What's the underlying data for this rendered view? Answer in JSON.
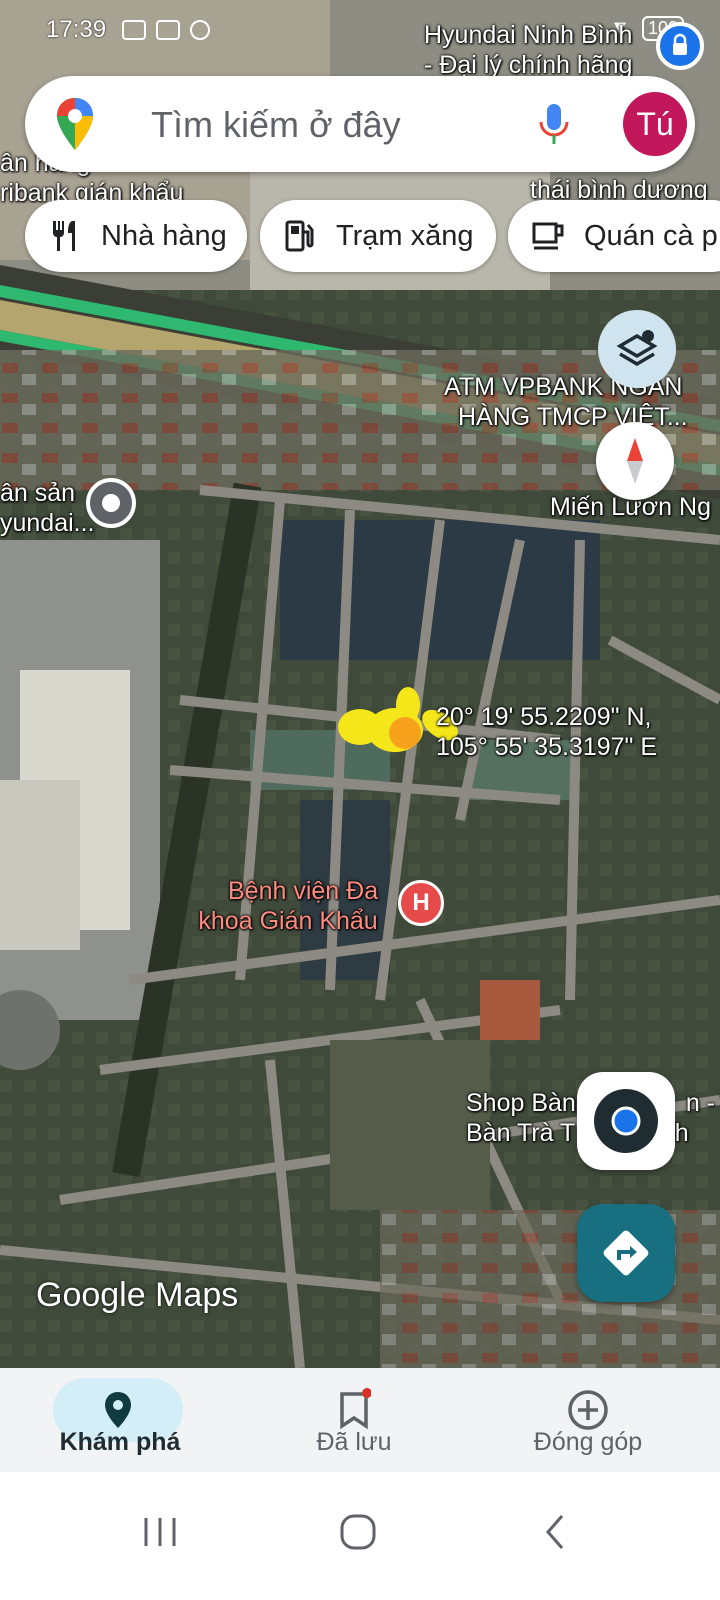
{
  "status_bar": {
    "time": "17:39",
    "battery": "100"
  },
  "search": {
    "placeholder": "Tìm kiếm ở đây",
    "avatar_initial": "Tú"
  },
  "chips": [
    {
      "label": "Nhà hàng",
      "icon": "restaurant-icon"
    },
    {
      "label": "Trạm xăng",
      "icon": "gas-station-icon"
    },
    {
      "label": "Quán cà p",
      "icon": "coffee-icon"
    }
  ],
  "map_labels": {
    "hyundai_line1": "Hyundai Ninh Bình",
    "hyundai_line2": "- Đại lý chính hãng",
    "bank_partial_line1": "ân hàng",
    "bank_partial_line2": "ribank gián khẩu",
    "thai_binh": "thái bình dương",
    "atm_line1": "ATM VPBANK NGÂN",
    "atm_line2": "HÀNG TMCP VIỆT...",
    "mien_luon": "Miến Lươn Ng",
    "hyundai_partial_line1": "ân sản",
    "hyundai_partial_line2": "yundai...",
    "coord_lat": "20° 19' 55.2209\" N,",
    "coord_lon": "105° 55' 35.3197\" E",
    "hospital_line1": "Bệnh viện Đa",
    "hospital_line2": "khoa Gián Khẩu",
    "shop_line1": "Shop Bàn",
    "shop_line1_end": "n -",
    "shop_line2": "Bàn Trà T",
    "shop_line2_end": "inh"
  },
  "logo": "Google Maps",
  "bottom_nav": [
    {
      "label": "Khám phá",
      "icon": "explore-pin-icon",
      "active": true
    },
    {
      "label": "Đã lưu",
      "icon": "bookmark-icon",
      "active": false
    },
    {
      "label": "Đóng góp",
      "icon": "add-circle-icon",
      "active": false
    }
  ],
  "colors": {
    "avatar": "#c2185b",
    "directions": "#186f80",
    "active_nav": "#d4eef7",
    "location_dot": "#1a73e8"
  }
}
